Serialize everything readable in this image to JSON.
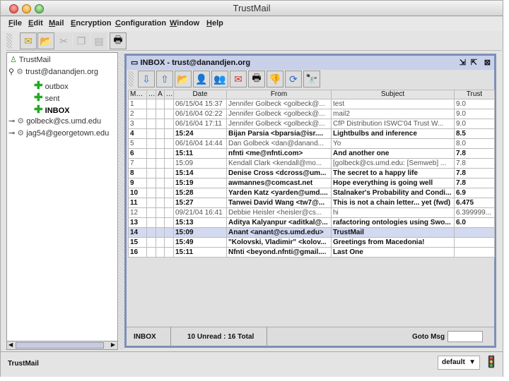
{
  "window": {
    "title": "TrustMail"
  },
  "menu": [
    "File",
    "Edit",
    "Mail",
    "Encryption",
    "Configuration",
    "Window",
    "Help"
  ],
  "main_toolbar": [
    {
      "icon": "compose-icon",
      "enabled": true
    },
    {
      "icon": "open-folder-icon",
      "enabled": true
    },
    {
      "icon": "cut-icon",
      "enabled": false
    },
    {
      "icon": "copy-icon",
      "enabled": false
    },
    {
      "icon": "paste-icon",
      "enabled": false
    },
    {
      "icon": "print-icon",
      "enabled": true
    }
  ],
  "tree": {
    "root": "TrustMail",
    "accounts": [
      {
        "name": "trust@danandjen.org",
        "folders": [
          "outbox",
          "sent",
          "INBOX"
        ]
      },
      {
        "name": "golbeck@cs.umd.edu"
      },
      {
        "name": "jag54@georgetown.edu"
      }
    ]
  },
  "inbox": {
    "title": "INBOX",
    "account": "trust@danandjen.org",
    "columns": [
      "Ms...",
      "...",
      "A",
      "...",
      "Date",
      "From",
      "Subject",
      "Trust"
    ],
    "rows": [
      {
        "n": "1",
        "date": "06/15/04 15:37",
        "from": "Jennifer Golbeck <golbeck@...",
        "subject": "test",
        "trust": "9.0",
        "unread": false
      },
      {
        "n": "2",
        "date": "06/16/04 02:22",
        "from": "Jennifer Golbeck <golbeck@...",
        "subject": "mail2",
        "trust": "9.0",
        "unread": false
      },
      {
        "n": "3",
        "date": "06/16/04 17:11",
        "from": "Jennifer Golbeck <golbeck@...",
        "subject": "CfP Distribution ISWC'04 Trust W...",
        "trust": "9.0",
        "unread": false
      },
      {
        "n": "4",
        "date": "15:24",
        "from": "Bijan Parsia <bparsia@isr....",
        "subject": "Lightbulbs and inference",
        "trust": "8.5",
        "unread": true
      },
      {
        "n": "5",
        "date": "06/16/04 14:44",
        "from": "Dan Golbeck <dan@danand...",
        "subject": "Yo",
        "trust": "8.0",
        "unread": false
      },
      {
        "n": "6",
        "date": "15:11",
        "from": "nfnti <me@nfnti.com>",
        "subject": "And another one",
        "trust": "7.8",
        "unread": true
      },
      {
        "n": "7",
        "date": "15:09",
        "from": "Kendall Clark <kendall@mo...",
        "subject": "[golbeck@cs.umd.edu: [Semweb] ...",
        "trust": "7.8",
        "unread": false
      },
      {
        "n": "8",
        "date": "15:14",
        "from": "Denise Cross <dcross@um...",
        "subject": "The secret to a happy life",
        "trust": "7.8",
        "unread": true
      },
      {
        "n": "9",
        "date": "15:19",
        "from": "awmannes@comcast.net",
        "subject": "Hope everything is going well",
        "trust": "7.8",
        "unread": true
      },
      {
        "n": "10",
        "date": "15:28",
        "from": "Yarden Katz <yarden@umd....",
        "subject": "Stalnaker's Probability and Condi...",
        "trust": "6.9",
        "unread": true
      },
      {
        "n": "11",
        "date": "15:27",
        "from": "Tanwei David Wang <tw7@...",
        "subject": "This is not a chain letter... yet (fwd)",
        "trust": "6.475",
        "unread": true
      },
      {
        "n": "12",
        "date": "09/21/04 16:41",
        "from": "Debbie Heisler <heisler@cs...",
        "subject": "hi",
        "trust": "6.399999...",
        "unread": false
      },
      {
        "n": "13",
        "date": "15:13",
        "from": "Aditya Kalyanpur <aditkal@...",
        "subject": "rafactoring ontologies using Swo...",
        "trust": "6.0",
        "unread": true
      },
      {
        "n": "14",
        "date": "15:09",
        "from": "Anant <anant@cs.umd.edu>",
        "subject": "TrustMail",
        "trust": "",
        "unread": true,
        "selected": true
      },
      {
        "n": "15",
        "date": "15:49",
        "from": "\"Kolovski, Vladimir\" <kolov...",
        "subject": "Greetings from Macedonia!",
        "trust": "",
        "unread": true
      },
      {
        "n": "16",
        "date": "15:11",
        "from": "Nfnti <beyond.nfnti@gmail....",
        "subject": "Last One",
        "trust": "",
        "unread": true
      }
    ],
    "status": {
      "folder": "INBOX",
      "counts": "10 Unread : 16 Total",
      "goto_label": "Goto Msg",
      "goto_value": ""
    }
  },
  "bottom": {
    "status": "TrustMail",
    "profile": "default"
  }
}
